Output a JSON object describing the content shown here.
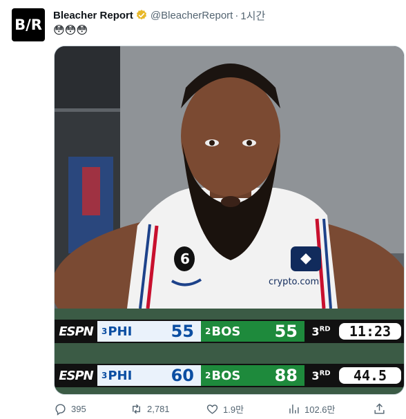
{
  "tweet": {
    "avatar_text": "B/R",
    "author_name": "Bleacher Report",
    "handle": "@BleacherReport",
    "separator": "·",
    "time": "1시간",
    "text": "😳😳😳"
  },
  "scoreboard_top": {
    "network": "ESPN",
    "home_seed": "3",
    "home_team": "PHI",
    "home_score": "55",
    "away_seed": "2",
    "away_team": "BOS",
    "away_score": "55",
    "period": "3",
    "period_suffix": "RD",
    "clock": "11:23"
  },
  "scoreboard_bottom": {
    "network": "ESPN",
    "home_seed": "3",
    "home_team": "PHI",
    "home_score": "60",
    "away_seed": "2",
    "away_team": "BOS",
    "away_score": "88",
    "period": "3",
    "period_suffix": "RD",
    "clock": "44.5"
  },
  "jersey": {
    "number": "6",
    "sponsor": "crypto.com"
  },
  "actions": {
    "replies": "395",
    "retweets": "2,781",
    "likes": "1.9만",
    "views": "102.6만"
  },
  "colors": {
    "verified": "#e8b829",
    "phi_blue": "#0b4ea2",
    "bos_green": "#1e8a3c",
    "text_secondary": "#536471"
  }
}
